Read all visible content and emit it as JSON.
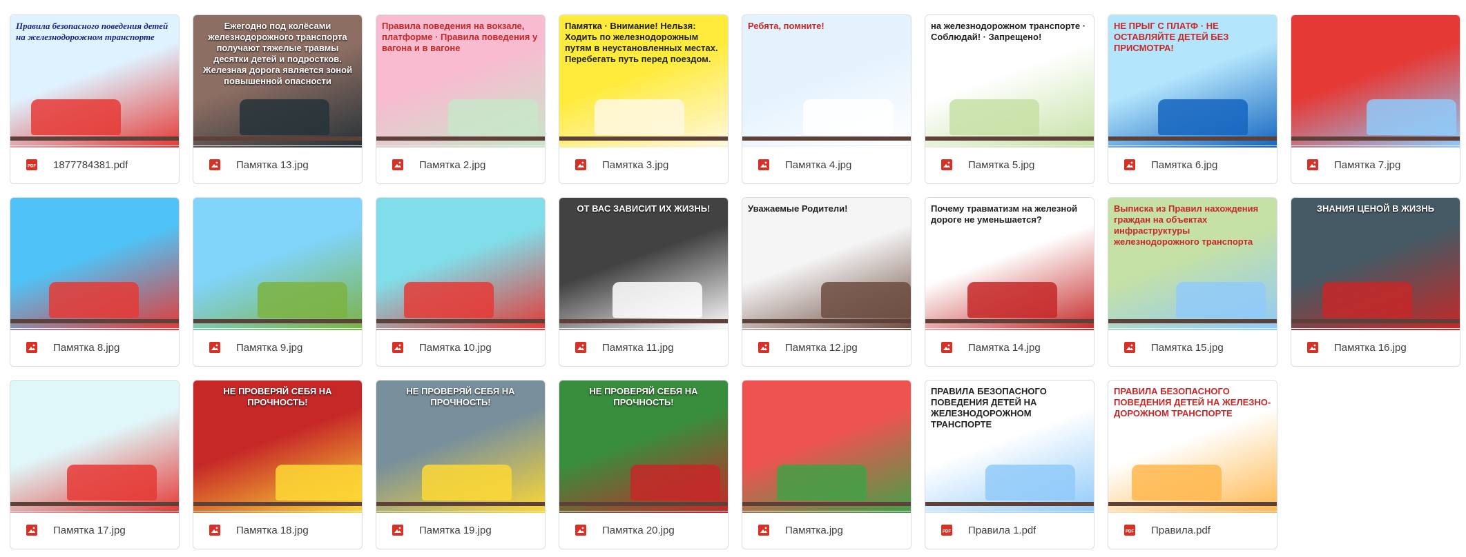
{
  "files": [
    {
      "name": "1877784381.pdf",
      "type": "pdf",
      "preview_text": "Правила безопасного поведения детей на железнодорожном транспорте",
      "preview_style": "italic",
      "colors": [
        "#dff2ff",
        "#e53935",
        "#1a237e"
      ]
    },
    {
      "name": "Памятка 13.jpg",
      "type": "image",
      "preview_text": "Ежегодно под колёсами железнодорожного транспорта получают тяжелые травмы десятки детей и подростков. Железная дорога является зоной повышенной опасности",
      "preview_style": "white",
      "colors": [
        "#8d6e63",
        "#263238"
      ]
    },
    {
      "name": "Памятка 2.jpg",
      "type": "image",
      "preview_text": "Правила поведения на вокзале, платформе · Правила поведения у вагона и в вагоне",
      "preview_style": "red",
      "colors": [
        "#f8bbd0",
        "#c8e6c9"
      ]
    },
    {
      "name": "Памятка 3.jpg",
      "type": "image",
      "preview_text": "Памятка · Внимание! Нельзя: Ходить по железнодорожным путям в неустановленных местах. Перебегать путь перед поездом.",
      "preview_style": "dark",
      "colors": [
        "#ffeb3b",
        "#fff8e1"
      ]
    },
    {
      "name": "Памятка 4.jpg",
      "type": "image",
      "preview_text": "Ребята, помните!",
      "preview_style": "red",
      "colors": [
        "#e3f2fd",
        "#ffffff"
      ]
    },
    {
      "name": "Памятка 5.jpg",
      "type": "image",
      "preview_text": "на железнодорожном транспорте · Соблюдай! · Запрещено!",
      "preview_style": "dark",
      "colors": [
        "#ffffff",
        "#c5e1a5"
      ]
    },
    {
      "name": "Памятка 6.jpg",
      "type": "image",
      "preview_text": "НЕ ПРЫГ С ПЛАТФ · НЕ ОСТАВЛЯЙТЕ ДЕТЕЙ БЕЗ ПРИСМОТРА!",
      "preview_style": "red",
      "colors": [
        "#b3e5fc",
        "#1565c0"
      ]
    },
    {
      "name": "Памятка 7.jpg",
      "type": "image",
      "preview_text": "",
      "preview_style": "none",
      "colors": [
        "#e53935",
        "#90caf9"
      ]
    },
    {
      "name": "Памятка 8.jpg",
      "type": "image",
      "preview_text": "",
      "preview_style": "none",
      "colors": [
        "#4fc3f7",
        "#e53935"
      ]
    },
    {
      "name": "Памятка 9.jpg",
      "type": "image",
      "preview_text": "",
      "preview_style": "none",
      "colors": [
        "#81d4fa",
        "#7cb342"
      ]
    },
    {
      "name": "Памятка 10.jpg",
      "type": "image",
      "preview_text": "",
      "preview_style": "none",
      "colors": [
        "#80deea",
        "#e53935"
      ]
    },
    {
      "name": "Памятка 11.jpg",
      "type": "image",
      "preview_text": "ОТ ВАС ЗАВИСИТ ИХ ЖИЗНЬ!",
      "preview_style": "white",
      "colors": [
        "#424242",
        "#ffffff"
      ]
    },
    {
      "name": "Памятка 12.jpg",
      "type": "image",
      "preview_text": "Уважаемые Родители!",
      "preview_style": "dark",
      "colors": [
        "#f5f5f5",
        "#6d4c41"
      ]
    },
    {
      "name": "Памятка 14.jpg",
      "type": "image",
      "preview_text": "Почему травматизм на железной дороге не уменьшается?",
      "preview_style": "dark",
      "colors": [
        "#ffffff",
        "#c62828"
      ]
    },
    {
      "name": "Памятка 15.jpg",
      "type": "image",
      "preview_text": "Выписка из Правил нахождения граждан на объектах инфраструктуры железнодорожного транспорта",
      "preview_style": "red",
      "colors": [
        "#c5e1a5",
        "#90caf9"
      ]
    },
    {
      "name": "Памятка 16.jpg",
      "type": "image",
      "preview_text": "ЗНАНИЯ ЦЕНОЙ В ЖИЗНЬ",
      "preview_style": "white",
      "colors": [
        "#455a64",
        "#c62828"
      ]
    },
    {
      "name": "Памятка 17.jpg",
      "type": "image",
      "preview_text": "",
      "preview_style": "none",
      "colors": [
        "#e0f7fa",
        "#e53935"
      ]
    },
    {
      "name": "Памятка 18.jpg",
      "type": "image",
      "preview_text": "НЕ ПРОВЕРЯЙ СЕБЯ НА ПРОЧНОСТЬ!",
      "preview_style": "white",
      "colors": [
        "#c62828",
        "#fdd835"
      ]
    },
    {
      "name": "Памятка 19.jpg",
      "type": "image",
      "preview_text": "НЕ ПРОВЕРЯЙ СЕБЯ НА ПРОЧНОСТЬ!",
      "preview_style": "white",
      "colors": [
        "#78909c",
        "#fdd835"
      ]
    },
    {
      "name": "Памятка 20.jpg",
      "type": "image",
      "preview_text": "НЕ ПРОВЕРЯЙ СЕБЯ НА ПРОЧНОСТЬ!",
      "preview_style": "white",
      "colors": [
        "#388e3c",
        "#c62828"
      ]
    },
    {
      "name": "Памятка.jpg",
      "type": "image",
      "preview_text": "",
      "preview_style": "none",
      "colors": [
        "#ef5350",
        "#43a047"
      ]
    },
    {
      "name": "Правила 1.pdf",
      "type": "pdf",
      "preview_text": "ПРАВИЛА БЕЗОПАСНОГО ПОВЕДЕНИЯ ДЕТЕЙ НА ЖЕЛЕЗНОДОРОЖНОМ ТРАНСПОРТЕ",
      "preview_style": "dark",
      "colors": [
        "#ffffff",
        "#90caf9"
      ]
    },
    {
      "name": "Правила.pdf",
      "type": "pdf",
      "preview_text": "ПРАВИЛА БЕЗОПАСНОГО ПОВЕДЕНИЯ ДЕТЕЙ НА ЖЕЛЕЗНО-ДОРОЖНОМ ТРАНСПОРТЕ",
      "preview_style": "red",
      "colors": [
        "#ffffff",
        "#ffb74d"
      ]
    }
  ],
  "icons": {
    "pdf": "pdf-file-icon",
    "image": "image-file-icon"
  },
  "accent": "#d93025"
}
